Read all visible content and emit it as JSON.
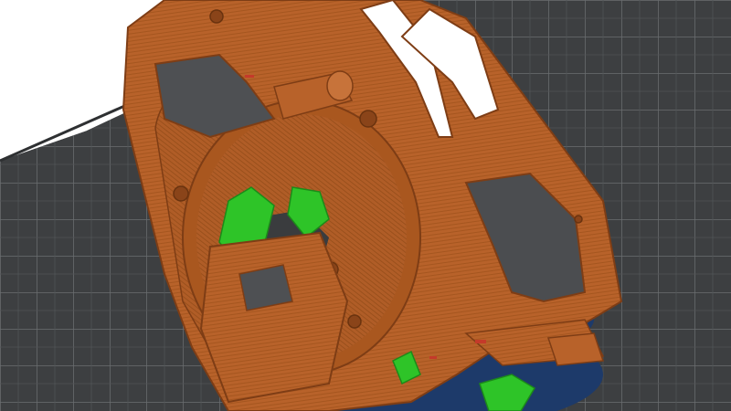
{
  "app": {
    "view": "slicer-preview",
    "icons": [
      "build-plate-grid",
      "sliced-model",
      "support-structure",
      "raft"
    ]
  },
  "colors": {
    "background": "#ffffff",
    "plate_base": "#3d3f41",
    "plate_grid": "#6a6d70",
    "plate_grid_minor": "#505355",
    "model_wall": "#b8622a",
    "model_wall_dark": "#8f4619",
    "model_wall_light": "#cc7a3d",
    "support": "#2ec428",
    "support_dark": "#1c8a19",
    "raft": "#1d3a6a",
    "seam_red": "#c43a2a"
  }
}
